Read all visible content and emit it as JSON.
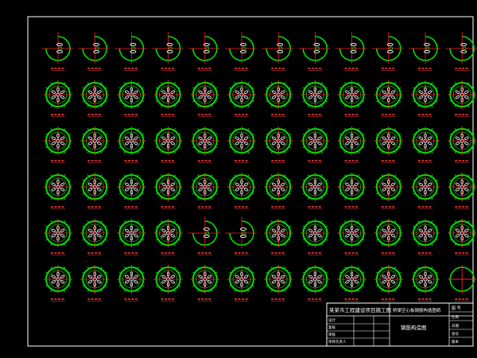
{
  "viewport": {
    "background": "#000000"
  },
  "colors": {
    "frame": "#ffffff",
    "ring": "#00e000",
    "ring_inner": "#00c000",
    "center_lines": "#ff2020",
    "bolt_holes": "#ffffff",
    "labels": "#ff4040",
    "title_block_highlight": "#00d000"
  },
  "grid": {
    "rows": 6,
    "cols": 12,
    "first_row_variant": "partial-section",
    "special_cells": [
      {
        "row": 4,
        "col": 4,
        "variant": "partial-section"
      },
      {
        "row": 4,
        "col": 5,
        "variant": "partial-section"
      },
      {
        "row": 5,
        "col": 11,
        "variant": "plain-cross"
      }
    ]
  },
  "title_block": {
    "project_title": "某某市工程建设项目施工图",
    "drawing_name": "桥梁空心板钢筋构造图纸",
    "drawing_title": "钢筋构造图",
    "labels": [
      "设计",
      "复核",
      "审核",
      "项目负责人"
    ],
    "right_top": "图 号",
    "right_labels": [
      "比例",
      "日期",
      "张号",
      "版本"
    ]
  }
}
